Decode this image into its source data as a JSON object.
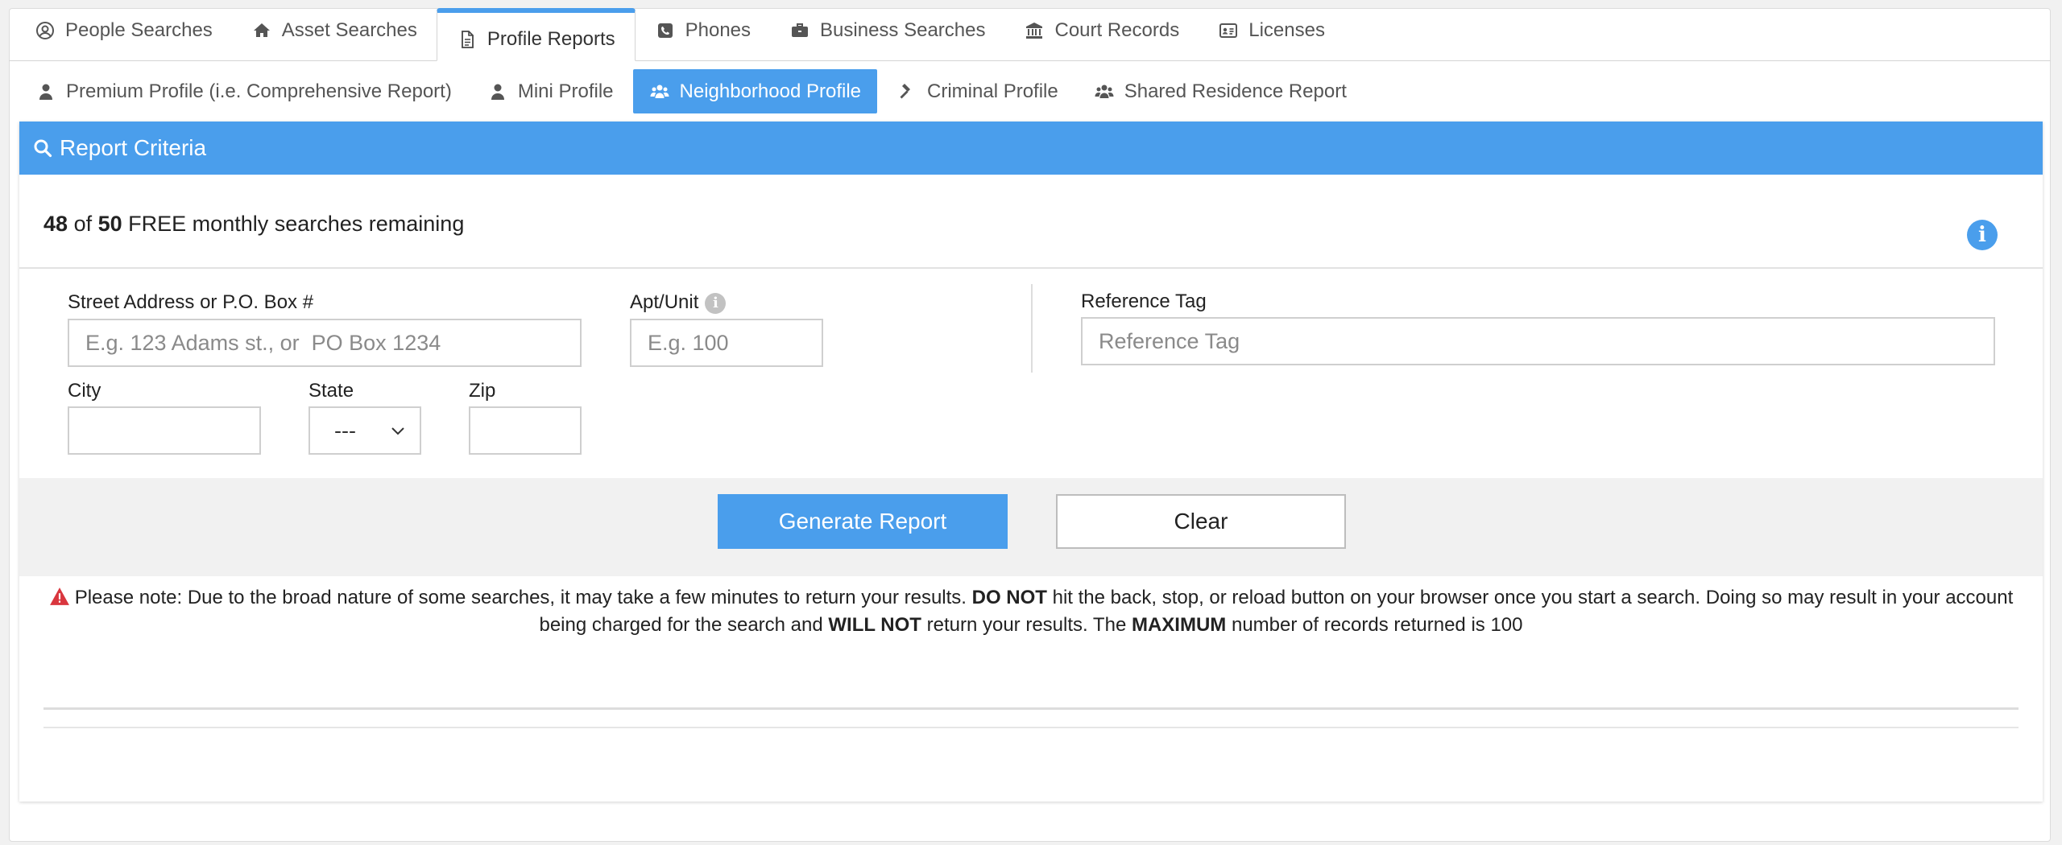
{
  "top_tabs": [
    {
      "label": "People Searches",
      "icon": "user-circle-icon"
    },
    {
      "label": "Asset Searches",
      "icon": "home-icon"
    },
    {
      "label": "Profile Reports",
      "icon": "document-icon",
      "active": true
    },
    {
      "label": "Phones",
      "icon": "phone-icon"
    },
    {
      "label": "Business Searches",
      "icon": "briefcase-icon"
    },
    {
      "label": "Court Records",
      "icon": "courthouse-icon"
    },
    {
      "label": "Licenses",
      "icon": "id-card-icon"
    }
  ],
  "sub_tabs": [
    {
      "label": "Premium Profile (i.e. Comprehensive Report)",
      "icon": "user-icon"
    },
    {
      "label": "Mini Profile",
      "icon": "user-icon"
    },
    {
      "label": "Neighborhood Profile",
      "icon": "users-icon",
      "active": true
    },
    {
      "label": "Criminal Profile",
      "icon": "gavel-icon"
    },
    {
      "label": "Shared Residence Report",
      "icon": "users-icon"
    }
  ],
  "panel": {
    "title": "Report Criteria",
    "quota_used": "48",
    "quota_of": "of",
    "quota_total": "50",
    "quota_text": "FREE monthly searches remaining"
  },
  "form": {
    "street_label": "Street Address or P.O. Box #",
    "street_placeholder": "E.g. 123 Adams st., or  PO Box 1234",
    "apt_label": "Apt/Unit",
    "apt_placeholder": "E.g. 100",
    "reference_label": "Reference Tag",
    "reference_placeholder": "Reference Tag",
    "city_label": "City",
    "state_label": "State",
    "state_value": "---",
    "zip_label": "Zip"
  },
  "actions": {
    "generate_label": "Generate Report",
    "clear_label": "Clear"
  },
  "note": {
    "part1": "Please note: Due to the broad nature of some searches, it may take a few minutes to return your results.",
    "bold1": "DO NOT",
    "part2": "hit the back, stop, or reload button on your browser once you start a search. Doing so may result in your account being charged for the search and",
    "bold2": "WILL NOT",
    "part3": "return your results. The",
    "bold3": "MAXIMUM",
    "part4": "number of records returned is 100"
  },
  "colors": {
    "accent": "#4a9eec",
    "warning": "#d9363e"
  }
}
